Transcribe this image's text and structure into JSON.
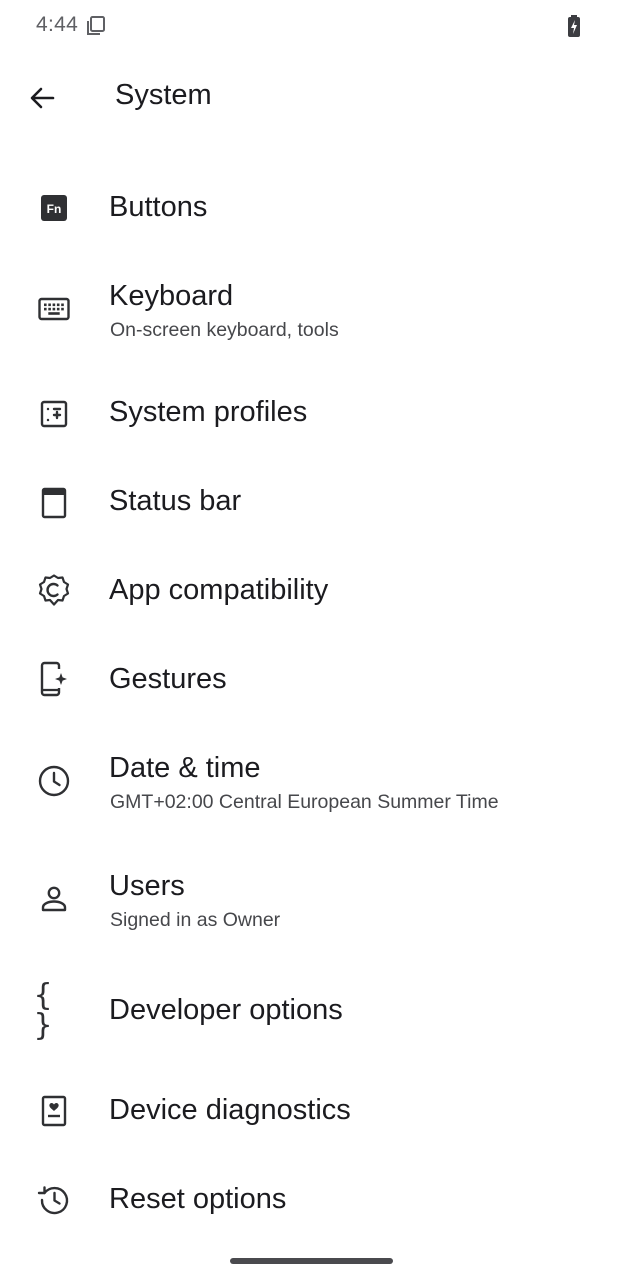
{
  "status_bar": {
    "time": "4:44"
  },
  "app_bar": {
    "title": "System"
  },
  "items": [
    {
      "title": "Buttons",
      "summary": "",
      "icon": "fn-key-icon"
    },
    {
      "title": "Keyboard",
      "summary": "On-screen keyboard, tools",
      "icon": "keyboard-icon"
    },
    {
      "title": "System profiles",
      "summary": "",
      "icon": "system-profiles-icon"
    },
    {
      "title": "Status bar",
      "summary": "",
      "icon": "status-bar-icon"
    },
    {
      "title": "App compatibility",
      "summary": "",
      "icon": "app-compatibility-icon"
    },
    {
      "title": "Gestures",
      "summary": "",
      "icon": "gestures-icon"
    },
    {
      "title": "Date & time",
      "summary": "GMT+02:00 Central European Summer Time",
      "icon": "clock-icon"
    },
    {
      "title": "Users",
      "summary": "Signed in as Owner",
      "icon": "user-icon"
    },
    {
      "title": "Developer options",
      "summary": "",
      "icon": "braces-icon",
      "glyph": "{ }"
    },
    {
      "title": "Device diagnostics",
      "summary": "",
      "icon": "device-diagnostics-icon"
    },
    {
      "title": "Reset options",
      "summary": "",
      "icon": "history-icon"
    }
  ],
  "colors": {
    "text_primary": "#1b1b1f",
    "text_secondary": "#46474b",
    "icon": "#2f3033",
    "background": "#ffffff"
  }
}
